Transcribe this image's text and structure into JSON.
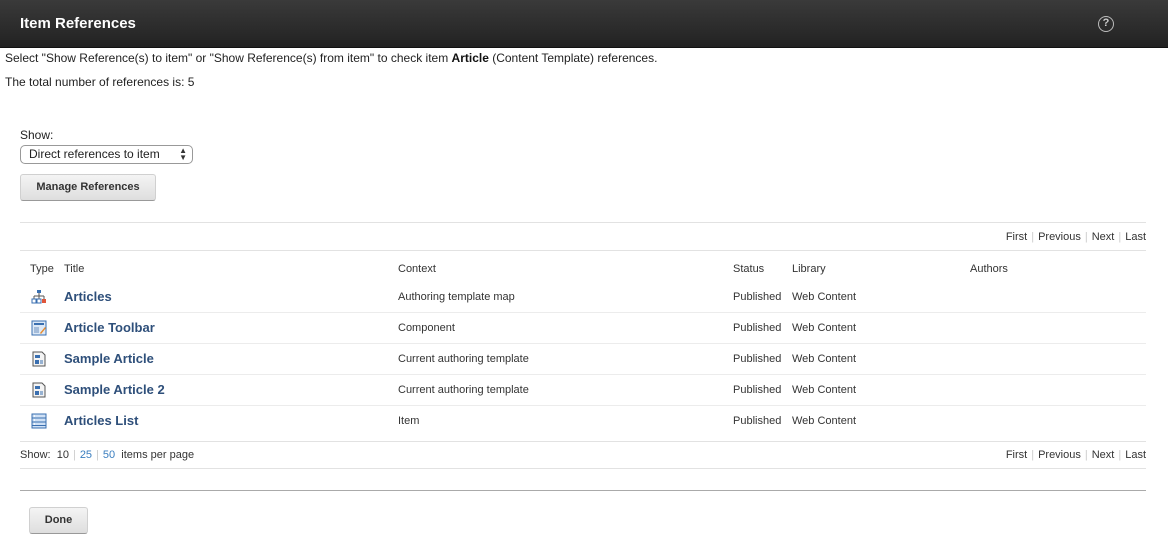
{
  "header": {
    "title": "Item References",
    "help_icon": "help-circle-icon"
  },
  "intro": {
    "prefix": "Select \"Show Reference(s) to item\" or \"Show Reference(s) from item\" to check item ",
    "item_name": "Article",
    "suffix": " (Content Template) references."
  },
  "total_text": "The total number of references is: 5",
  "show": {
    "label": "Show:",
    "selected": "Direct references to item"
  },
  "buttons": {
    "manage": "Manage References",
    "done": "Done"
  },
  "pager": {
    "first": "First",
    "previous": "Previous",
    "next": "Next",
    "last": "Last"
  },
  "table": {
    "columns": [
      "Type",
      "Title",
      "Context",
      "Status",
      "Library",
      "Authors"
    ],
    "rows": [
      {
        "type_icon": "template-map-icon",
        "title": "Articles",
        "context": "Authoring template map",
        "status": "Published",
        "library": "Web Content",
        "authors": ""
      },
      {
        "type_icon": "component-icon",
        "title": "Article Toolbar",
        "context": "Component",
        "status": "Published",
        "library": "Web Content",
        "authors": ""
      },
      {
        "type_icon": "content-template-icon",
        "title": "Sample Article",
        "context": "Current authoring template",
        "status": "Published",
        "library": "Web Content",
        "authors": ""
      },
      {
        "type_icon": "content-template-icon",
        "title": "Sample Article 2",
        "context": "Current authoring template",
        "status": "Published",
        "library": "Web Content",
        "authors": ""
      },
      {
        "type_icon": "list-icon",
        "title": "Articles List",
        "context": "Item",
        "status": "Published",
        "library": "Web Content",
        "authors": ""
      }
    ]
  },
  "per_page": {
    "label": "Show:",
    "current": "10",
    "options": [
      "25",
      "50"
    ],
    "suffix": "items per page"
  }
}
